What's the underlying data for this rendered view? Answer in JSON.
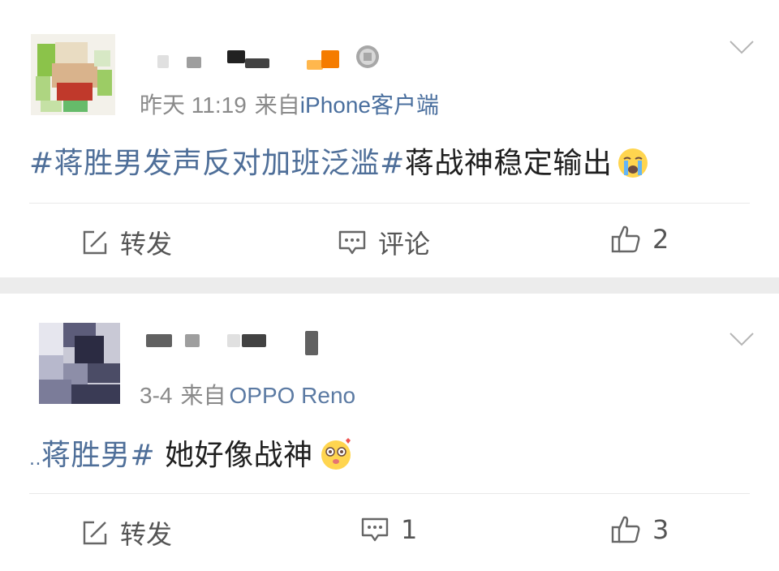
{
  "posts": [
    {
      "time": "昨天 11:19",
      "from_label": "来自",
      "device": "iPhone客户端",
      "hashtag": "#蒋胜男发声反对加班泛滥#",
      "text": "蒋战神稳定输出",
      "emoji": "crying-emoji",
      "actions": {
        "repost": "转发",
        "comment": "评论",
        "likes": "2"
      }
    },
    {
      "time": "3-4",
      "from_label": "来自",
      "device": "OPPO Reno",
      "hashtag_prefix": "..",
      "hashtag": "蒋胜男#",
      "text": " 她好像战神",
      "emoji": "admiring-emoji",
      "actions": {
        "repost": "转发",
        "comments": "1",
        "likes": "3"
      }
    }
  ],
  "colors": {
    "link": "#4f6f99",
    "meta": "#8a8a8a",
    "background": "#ececec"
  }
}
